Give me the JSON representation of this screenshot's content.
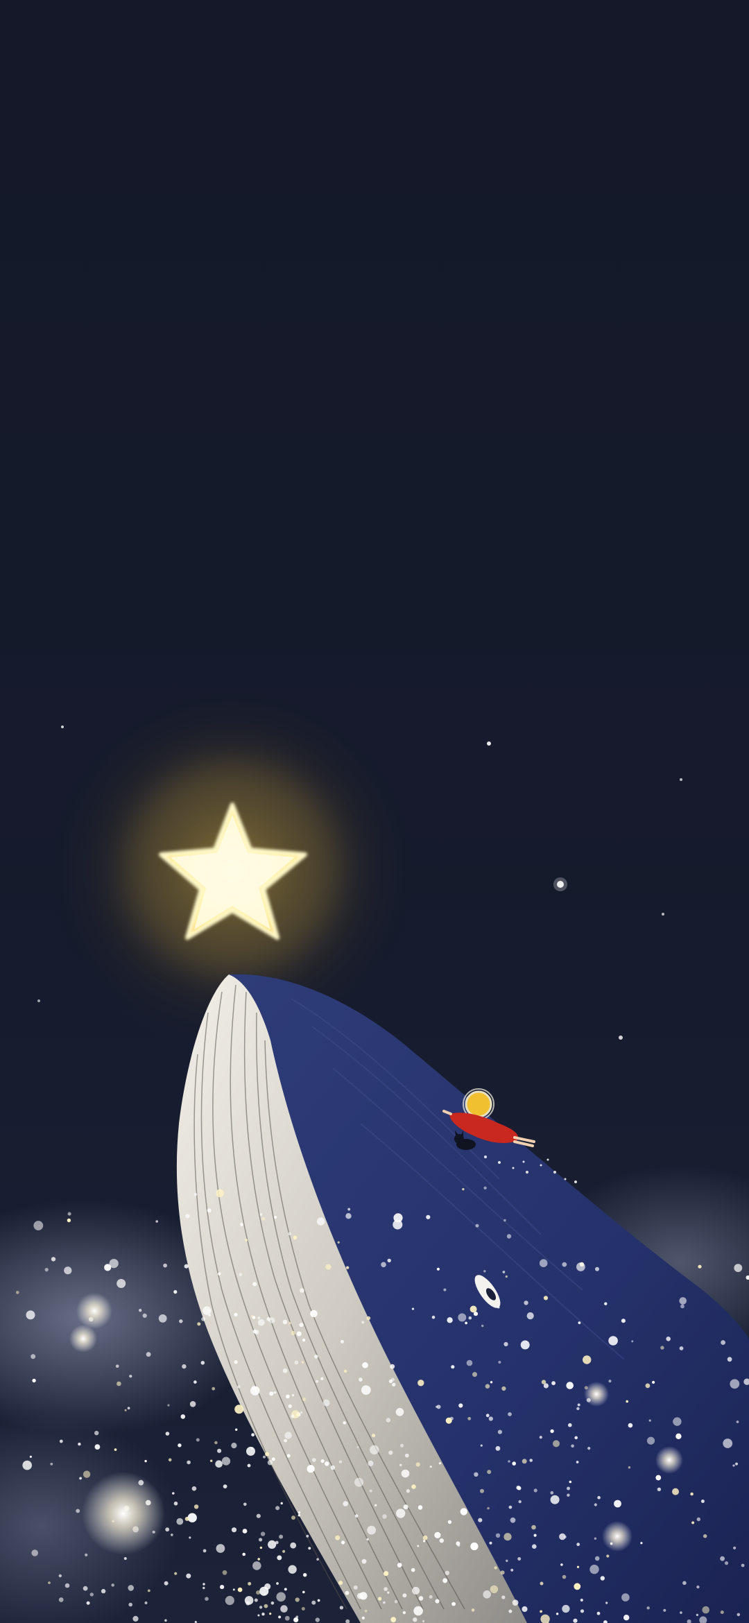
{
  "scene": {
    "background_top": "#141828",
    "background_bottom": "#1a2036",
    "star_color": "#fff3b0",
    "star_glow": "#f5c842",
    "whale_light": "#e8e4dc",
    "whale_dark": "#2a3a78",
    "girl_dress": "#c8281e",
    "girl_hair": "#f0c030",
    "sparkle_color": "#ffffff"
  },
  "icons": [
    "star-icon",
    "whale-icon",
    "girl-figure",
    "cat-figure"
  ]
}
